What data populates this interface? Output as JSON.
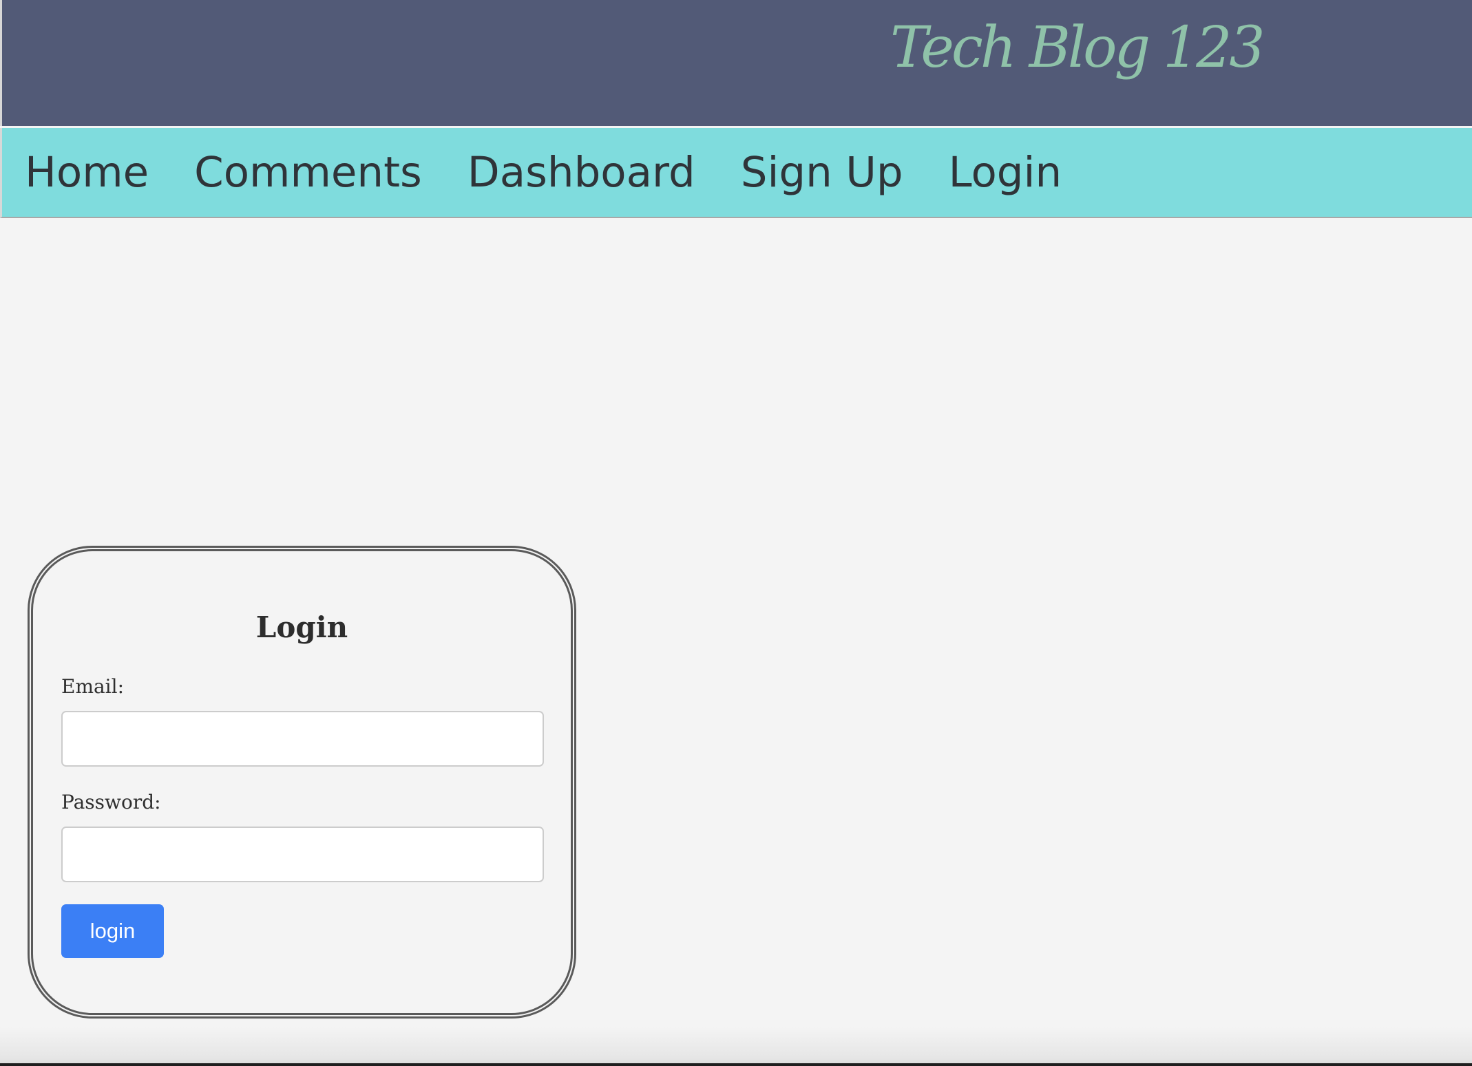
{
  "header": {
    "site_title": "Tech Blog 123"
  },
  "nav": {
    "items": [
      {
        "label": "Home"
      },
      {
        "label": "Comments"
      },
      {
        "label": "Dashboard"
      },
      {
        "label": "Sign Up"
      },
      {
        "label": "Login"
      }
    ]
  },
  "login_form": {
    "title": "Login",
    "email_label": "Email:",
    "email_value": "",
    "password_label": "Password:",
    "password_value": "",
    "submit_label": "login"
  },
  "colors": {
    "header_bg": "#525a77",
    "title_color": "#8fc2a9",
    "nav_bg": "#7fdcdd",
    "page_bg": "#f4f4f4",
    "button_bg": "#3b7ff5"
  }
}
